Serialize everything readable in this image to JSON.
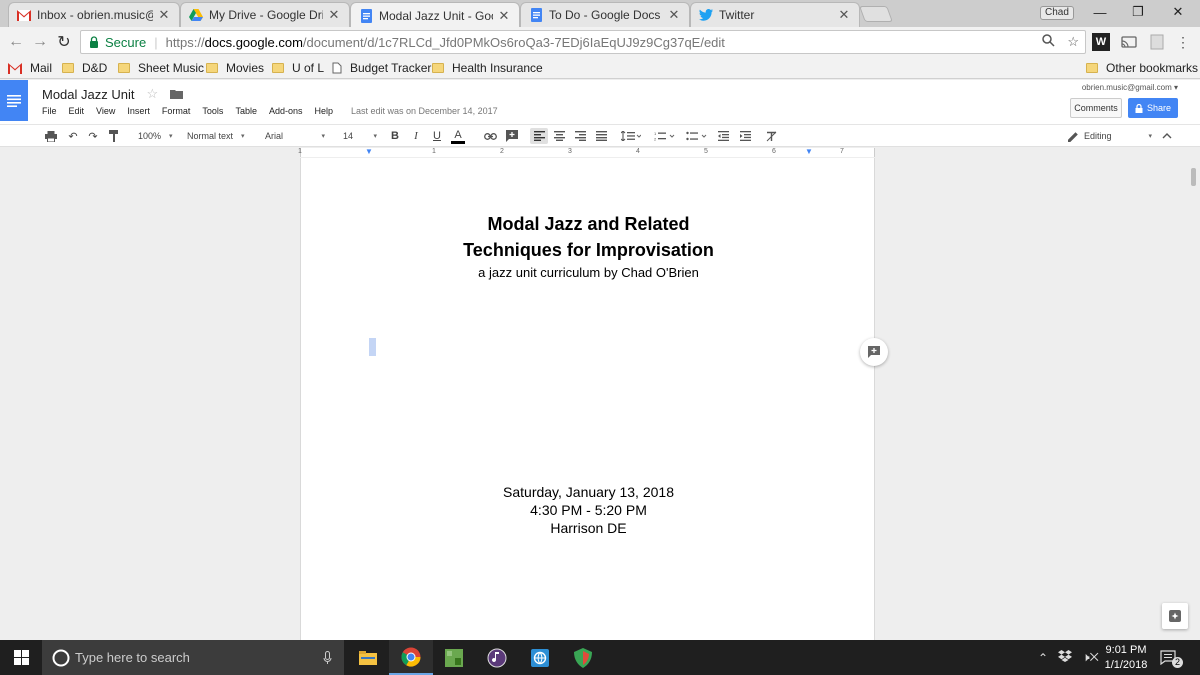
{
  "browser": {
    "tabs": [
      {
        "title": "Inbox - obrien.music@gm",
        "icon": "gmail-icon"
      },
      {
        "title": "My Drive - Google Drive",
        "icon": "drive-icon"
      },
      {
        "title": "Modal Jazz Unit - Google",
        "icon": "docs-icon"
      },
      {
        "title": "To Do - Google Docs",
        "icon": "docs-icon"
      },
      {
        "title": "Twitter",
        "icon": "twitter-icon"
      }
    ],
    "profile_name": "Chad",
    "secure_label": "Secure",
    "url_scheme": "https://",
    "url_host": "docs.google.com",
    "url_path": "/document/d/1c7RLCd_Jfd0PMkOs6roQa3-7EDj6IaEqUJ9z9Cg37qE/edit",
    "bookmarks": [
      "Mail",
      "D&D",
      "Sheet Music",
      "Movies",
      "U of L",
      "Budget Tracker",
      "Health Insurance"
    ],
    "other_bookmarks": "Other bookmarks"
  },
  "doc": {
    "title": "Modal Jazz Unit",
    "menu": [
      "File",
      "Edit",
      "View",
      "Insert",
      "Format",
      "Tools",
      "Table",
      "Add-ons",
      "Help"
    ],
    "last_edit": "Last edit was on December 14, 2017",
    "account": "obrien.music@gmail.com",
    "comments_label": "Comments",
    "share_label": "Share"
  },
  "toolbar": {
    "zoom": "100%",
    "style": "Normal text",
    "font": "Arial",
    "size": "14",
    "bold": "B",
    "italic": "I",
    "underline": "U",
    "textcolor": "A",
    "mode": "Editing"
  },
  "ruler": {
    "numbers": [
      "1",
      "1",
      "2",
      "3",
      "4",
      "5",
      "6",
      "7"
    ]
  },
  "content": {
    "title_line1": "Modal Jazz and Related",
    "title_line2": "Techniques for Improvisation",
    "subtitle": "a jazz unit curriculum by Chad O'Brien",
    "date": "Saturday, January 13, 2018",
    "time": "4:30 PM - 5:20 PM",
    "location": "Harrison DE"
  },
  "taskbar": {
    "search_placeholder": "Type here to search",
    "time": "9:01 PM",
    "date": "1/1/2018",
    "notifications": "2"
  },
  "colors": {
    "docs_blue": "#4285f4",
    "secure_green": "#0b8043"
  }
}
